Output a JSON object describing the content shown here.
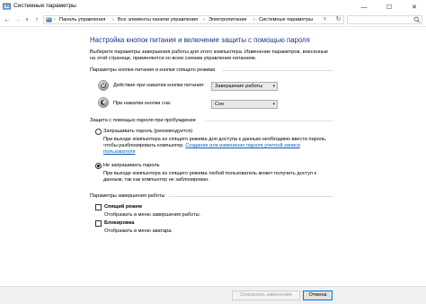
{
  "window": {
    "title": "Системные параметры",
    "minimize_glyph": "—",
    "maximize_glyph": "☐",
    "close_glyph": "✕"
  },
  "nav": {
    "back_glyph": "←",
    "forward_glyph": "→",
    "up_glyph": "↑",
    "breadcrumbs": [
      "Панель управления",
      "Все элементы панели управления",
      "Электропитание",
      "Системные параметры"
    ],
    "separator": "›",
    "chevron_glyph": "∨",
    "refresh_glyph": "↻",
    "search_placeholder": ""
  },
  "page": {
    "title": "Настройка кнопок питания и включение защиты с помощью пароля",
    "intro": "Выберите параметры завершения работы для этого компьютера. Изменение параметров, внесенные на этой странице, применяются ко всем схемам управления питанием."
  },
  "power_buttons": {
    "heading": "Параметры кнопки питания и кнопки спящего режима",
    "rows": [
      {
        "label": "Действие при нажатии кнопки питания:",
        "value": "Завершение работы"
      },
      {
        "label": "При нажатии кнопки сна:",
        "value": "Сон"
      }
    ],
    "dropdown_arrow": "▾"
  },
  "password": {
    "heading": "Защита с помощью пароля при пробуждении",
    "option1": {
      "label": "Запрашивать пароль (рекомендуется)",
      "desc_text": "При выходе компьютера из спящего режима для доступа к данным необходимо ввести пароль, чтобы разблокировать компьютер.",
      "link": "Создание или изменение пароля учетной записи пользователя",
      "checked": false
    },
    "option2": {
      "label": "Не запрашивать пароль",
      "desc": "При выходе компьютера из спящего режима любой пользователь может получить доступ к данным, так как компьютер не заблокирован.",
      "checked": true
    }
  },
  "shutdown": {
    "heading": "Параметры завершения работы",
    "items": [
      {
        "label": "Спящий режим",
        "desc": "Отображать в меню завершения работы.",
        "checked": false
      },
      {
        "label": "Блокировка",
        "desc": "Отображать в меню аватара.",
        "checked": false
      }
    ]
  },
  "footer": {
    "save_label": "Сохранить изменения",
    "cancel_label": "Отмена"
  },
  "colors": {
    "title_blue": "#1e3287",
    "link_blue": "#0a5cb8",
    "focus_blue": "#0078d7"
  }
}
